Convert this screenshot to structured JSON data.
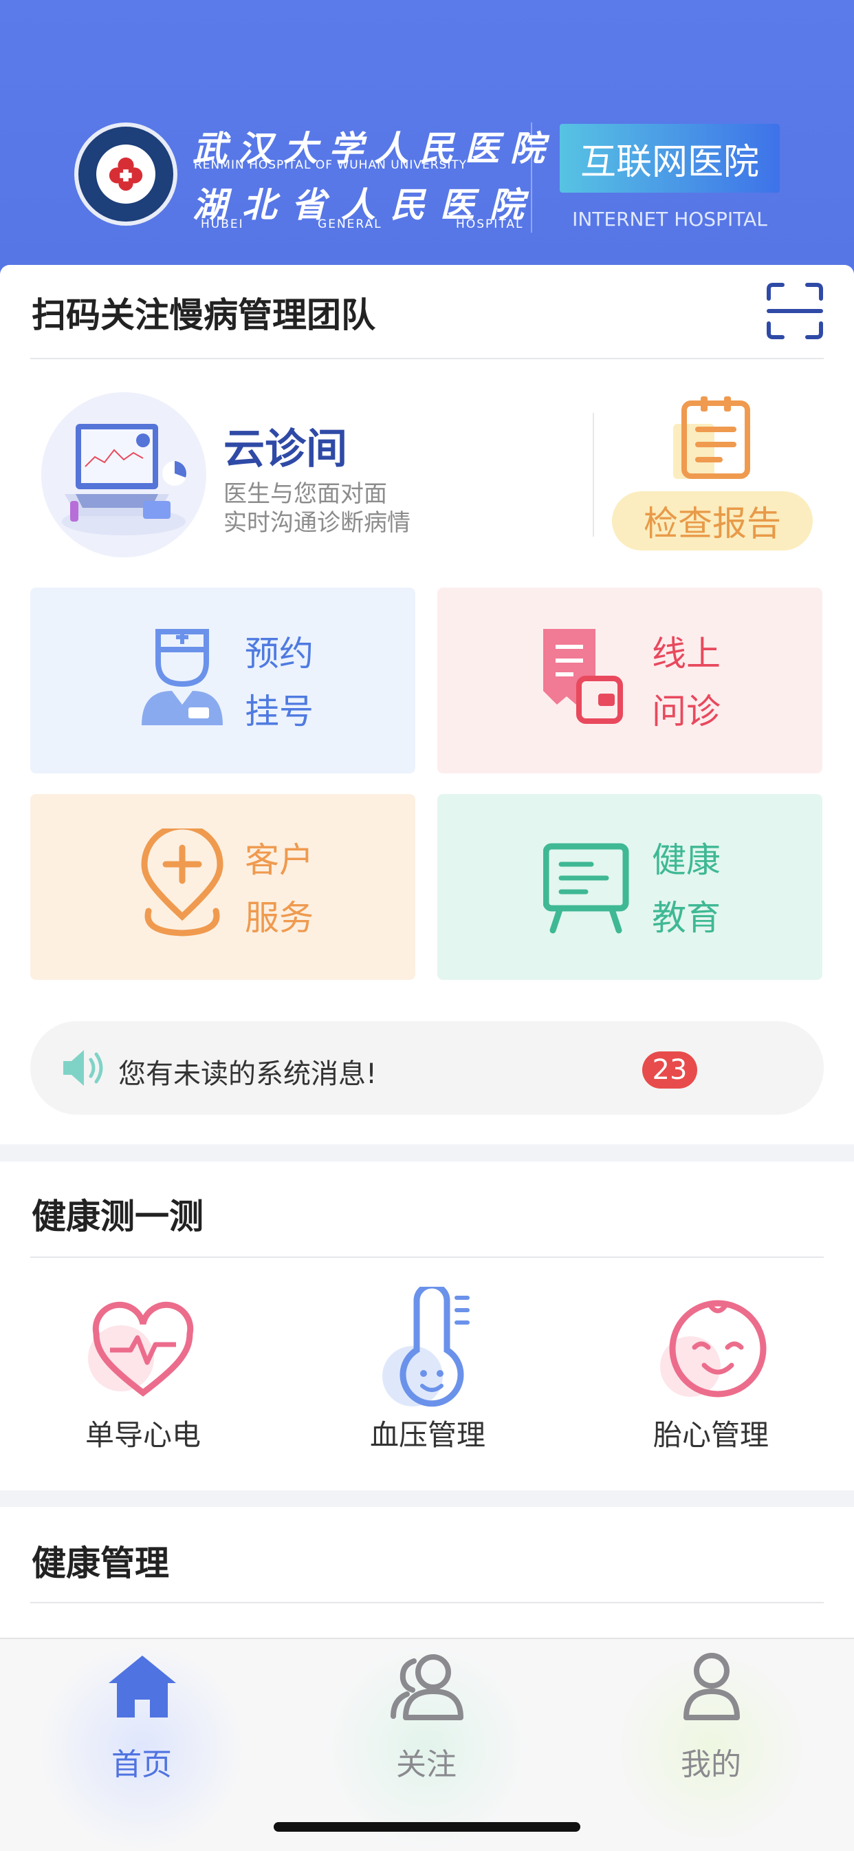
{
  "header": {
    "hospital_cn_line1": "武汉大学人民医院",
    "hospital_en_line1": "RENMIN HOSPITAL OF WUHAN UNIVERSITY",
    "hospital_cn_line2": "湖北省人民医院",
    "hospital_en_line2": "HUBEI GENERAL HOSPITAL",
    "internet_hospital_cn": "互联网医院",
    "internet_hospital_en": "INTERNET HOSPITAL"
  },
  "scan": {
    "title": "扫码关注慢病管理团队",
    "icon": "scan-icon"
  },
  "cloud_clinic": {
    "title": "云诊间",
    "subtitle_line1": "医生与您面对面",
    "subtitle_line2": "实时沟通诊断病情"
  },
  "report": {
    "label": "检查报告",
    "icon": "clipboard-icon"
  },
  "tiles": [
    {
      "line1": "预约",
      "line2": "挂号",
      "icon": "doctor-icon",
      "bg": "#ecf3fd",
      "color": "#4f7ae0"
    },
    {
      "line1": "线上",
      "line2": "问诊",
      "icon": "online-consult-icon",
      "bg": "#fdeeee",
      "color": "#e8495d"
    },
    {
      "line1": "客户",
      "line2": "服务",
      "icon": "customer-service-icon",
      "bg": "#fdf0e1",
      "color": "#ef9a4f"
    },
    {
      "line1": "健康",
      "line2": "教育",
      "icon": "education-board-icon",
      "bg": "#e3f6ef",
      "color": "#3fb894"
    }
  ],
  "notice": {
    "text": "您有未读的系统消息!",
    "count": "23",
    "icon": "speaker-icon"
  },
  "health_check": {
    "title": "健康测一测",
    "items": [
      {
        "label": "单导心电",
        "icon": "heart-ecg-icon"
      },
      {
        "label": "血压管理",
        "icon": "thermometer-icon"
      },
      {
        "label": "胎心管理",
        "icon": "baby-face-icon"
      }
    ]
  },
  "health_mgmt": {
    "title": "健康管理"
  },
  "tabbar": {
    "items": [
      {
        "label": "首页",
        "icon": "home-icon",
        "active": true
      },
      {
        "label": "关注",
        "icon": "users-icon",
        "active": false
      },
      {
        "label": "我的",
        "icon": "user-icon",
        "active": false
      }
    ]
  },
  "colors": {
    "primary": "#5b7bea",
    "badge": "#e84b4b",
    "report_text": "#e89a48"
  }
}
